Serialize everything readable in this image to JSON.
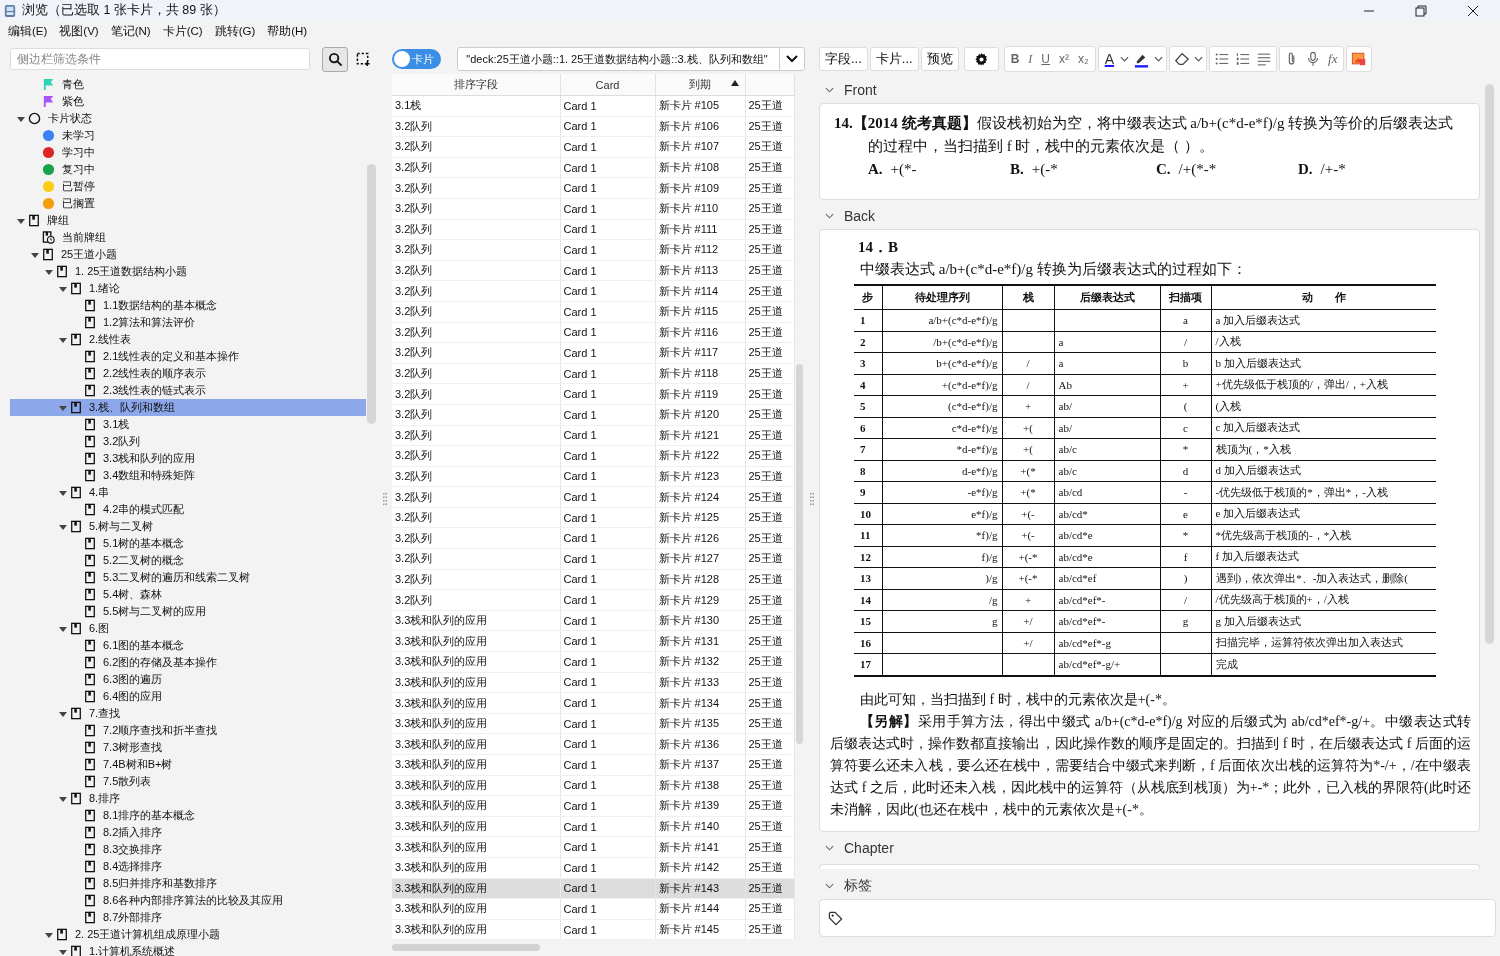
{
  "window": {
    "title": "浏览（已选取 1 张卡片，共 89 张）"
  },
  "menu": [
    "编辑(E)",
    "视图(V)",
    "笔记(N)",
    "卡片(C)",
    "跳转(G)",
    "帮助(H)"
  ],
  "sidebar": {
    "search": {
      "placeholder": "侧边栏筛选条件"
    },
    "continued_items": [
      {
        "label": "青色",
        "kind": "flag",
        "color": "#2ed3b7",
        "selected": false
      },
      {
        "label": "紫色",
        "kind": "flag",
        "color": "#a855f7",
        "selected": false
      }
    ],
    "items": [
      {
        "label": "卡片状态",
        "kind": "state",
        "expanded": true,
        "selected": false,
        "children": [
          {
            "label": "未学习",
            "kind": "dot",
            "color": "#3b82f6",
            "selected": false
          },
          {
            "label": "学习中",
            "kind": "dot",
            "color": "#dc2626",
            "selected": false
          },
          {
            "label": "复习中",
            "kind": "dot",
            "color": "#16a34a",
            "selected": false
          },
          {
            "label": "已暂停",
            "kind": "dot",
            "color": "#facc15",
            "selected": false
          },
          {
            "label": "已搁置",
            "kind": "dot",
            "color": "#f59e0b",
            "selected": false
          }
        ]
      },
      {
        "label": "牌组",
        "kind": "deck",
        "expanded": true,
        "selected": false,
        "children": [
          {
            "label": "当前牌组",
            "kind": "current",
            "selected": false
          },
          {
            "label": "25王道小题",
            "kind": "deck",
            "expanded": true,
            "selected": false,
            "children": [
              {
                "label": "1.  25王道数据结构小题",
                "kind": "deck",
                "expanded": true,
                "selected": false,
                "children": [
                  {
                    "label": "1.绪论",
                    "kind": "deck",
                    "expanded": true,
                    "selected": false,
                    "children": [
                      {
                        "label": "1.1数据结构的基本概念",
                        "kind": "deck",
                        "selected": false
                      },
                      {
                        "label": "1.2算法和算法评价",
                        "kind": "deck",
                        "selected": false
                      }
                    ]
                  },
                  {
                    "label": "2.线性表",
                    "kind": "deck",
                    "expanded": true,
                    "selected": false,
                    "children": [
                      {
                        "label": "2.1线性表的定义和基本操作",
                        "kind": "deck",
                        "selected": false
                      },
                      {
                        "label": "2.2线性表的顺序表示",
                        "kind": "deck",
                        "selected": false
                      },
                      {
                        "label": "2.3线性表的链式表示",
                        "kind": "deck",
                        "selected": false
                      }
                    ]
                  },
                  {
                    "label": "3.栈、队列和数组",
                    "kind": "deck",
                    "expanded": true,
                    "selected": true,
                    "children": [
                      {
                        "label": "3.1栈",
                        "kind": "deck",
                        "selected": false
                      },
                      {
                        "label": "3.2队列",
                        "kind": "deck",
                        "selected": false
                      },
                      {
                        "label": "3.3栈和队列的应用",
                        "kind": "deck",
                        "selected": false
                      },
                      {
                        "label": "3.4数组和特殊矩阵",
                        "kind": "deck",
                        "selected": false
                      }
                    ]
                  },
                  {
                    "label": "4.串",
                    "kind": "deck",
                    "expanded": true,
                    "selected": false,
                    "children": [
                      {
                        "label": "4.2串的模式匹配",
                        "kind": "deck",
                        "selected": false
                      }
                    ]
                  },
                  {
                    "label": "5.树与二叉树",
                    "kind": "deck",
                    "expanded": true,
                    "selected": false,
                    "children": [
                      {
                        "label": "5.1树的基本概念",
                        "kind": "deck",
                        "selected": false
                      },
                      {
                        "label": "5.2二叉树的概念",
                        "kind": "deck",
                        "selected": false
                      },
                      {
                        "label": "5.3二叉树的遍历和线索二叉树",
                        "kind": "deck",
                        "selected": false
                      },
                      {
                        "label": "5.4树、森林",
                        "kind": "deck",
                        "selected": false
                      },
                      {
                        "label": "5.5树与二叉树的应用",
                        "kind": "deck",
                        "selected": false
                      }
                    ]
                  },
                  {
                    "label": "6.图",
                    "kind": "deck",
                    "expanded": true,
                    "selected": false,
                    "children": [
                      {
                        "label": "6.1图的基本概念",
                        "kind": "deck",
                        "selected": false
                      },
                      {
                        "label": "6.2图的存储及基本操作",
                        "kind": "deck",
                        "selected": false
                      },
                      {
                        "label": "6.3图的遍历",
                        "kind": "deck",
                        "selected": false
                      },
                      {
                        "label": "6.4图的应用",
                        "kind": "deck",
                        "selected": false
                      }
                    ]
                  },
                  {
                    "label": "7.查找",
                    "kind": "deck",
                    "expanded": true,
                    "selected": false,
                    "children": [
                      {
                        "label": "7.2顺序查找和折半查找",
                        "kind": "deck",
                        "selected": false
                      },
                      {
                        "label": "7.3树形查找",
                        "kind": "deck",
                        "selected": false
                      },
                      {
                        "label": "7.4B树和B+树",
                        "kind": "deck",
                        "selected": false
                      },
                      {
                        "label": "7.5散列表",
                        "kind": "deck",
                        "selected": false
                      }
                    ]
                  },
                  {
                    "label": "8.排序",
                    "kind": "deck",
                    "expanded": true,
                    "selected": false,
                    "children": [
                      {
                        "label": "8.1排序的基本概念",
                        "kind": "deck",
                        "selected": false
                      },
                      {
                        "label": "8.2插入排序",
                        "kind": "deck",
                        "selected": false
                      },
                      {
                        "label": "8.3交换排序",
                        "kind": "deck",
                        "selected": false
                      },
                      {
                        "label": "8.4选择排序",
                        "kind": "deck",
                        "selected": false
                      },
                      {
                        "label": "8.5归并排序和基数排序",
                        "kind": "deck",
                        "selected": false
                      },
                      {
                        "label": "8.6各种内部排序算法的比较及其应用",
                        "kind": "deck",
                        "selected": false
                      },
                      {
                        "label": "8.7外部排序",
                        "kind": "deck",
                        "selected": false
                      }
                    ]
                  }
                ]
              },
              {
                "label": "2.  25王道计算机组成原理小题",
                "kind": "deck",
                "expanded": true,
                "selected": false,
                "children": [
                  {
                    "label": "1.计算机系统概述",
                    "kind": "deck",
                    "expanded": true,
                    "selected": false
                  }
                ]
              }
            ]
          }
        ]
      }
    ]
  },
  "browser": {
    "mode_toggle": {
      "label": "卡片"
    },
    "search": {
      "value": "\"deck:25王道小题::1.  25王道数据结构小题::3.栈、队列和数组\""
    },
    "table": {
      "columns": [
        {
          "label": "排序字段",
          "sorted": false
        },
        {
          "label": "Card",
          "sorted": false
        },
        {
          "label": "到期",
          "sorted": true
        },
        {
          "sorted": false
        }
      ],
      "rows": [
        {
          "sort_field": "3.1栈",
          "card": "Card 1",
          "due": "新卡片 #105",
          "column_4": "25王道",
          "selected": false
        },
        {
          "sort_field": "3.2队列",
          "card": "Card 1",
          "due": "新卡片 #106",
          "column_4": "25王道",
          "selected": false
        },
        {
          "sort_field": "3.2队列",
          "card": "Card 1",
          "due": "新卡片 #107",
          "column_4": "25王道",
          "selected": false
        },
        {
          "sort_field": "3.2队列",
          "card": "Card 1",
          "due": "新卡片 #108",
          "column_4": "25王道",
          "selected": false
        },
        {
          "sort_field": "3.2队列",
          "card": "Card 1",
          "due": "新卡片 #109",
          "column_4": "25王道",
          "selected": false
        },
        {
          "sort_field": "3.2队列",
          "card": "Card 1",
          "due": "新卡片 #110",
          "column_4": "25王道",
          "selected": false
        },
        {
          "sort_field": "3.2队列",
          "card": "Card 1",
          "due": "新卡片 #111",
          "column_4": "25王道",
          "selected": false
        },
        {
          "sort_field": "3.2队列",
          "card": "Card 1",
          "due": "新卡片 #112",
          "column_4": "25王道",
          "selected": false
        },
        {
          "sort_field": "3.2队列",
          "card": "Card 1",
          "due": "新卡片 #113",
          "column_4": "25王道",
          "selected": false
        },
        {
          "sort_field": "3.2队列",
          "card": "Card 1",
          "due": "新卡片 #114",
          "column_4": "25王道",
          "selected": false
        },
        {
          "sort_field": "3.2队列",
          "card": "Card 1",
          "due": "新卡片 #115",
          "column_4": "25王道",
          "selected": false
        },
        {
          "sort_field": "3.2队列",
          "card": "Card 1",
          "due": "新卡片 #116",
          "column_4": "25王道",
          "selected": false
        },
        {
          "sort_field": "3.2队列",
          "card": "Card 1",
          "due": "新卡片 #117",
          "column_4": "25王道",
          "selected": false
        },
        {
          "sort_field": "3.2队列",
          "card": "Card 1",
          "due": "新卡片 #118",
          "column_4": "25王道",
          "selected": false
        },
        {
          "sort_field": "3.2队列",
          "card": "Card 1",
          "due": "新卡片 #119",
          "column_4": "25王道",
          "selected": false
        },
        {
          "sort_field": "3.2队列",
          "card": "Card 1",
          "due": "新卡片 #120",
          "column_4": "25王道",
          "selected": false
        },
        {
          "sort_field": "3.2队列",
          "card": "Card 1",
          "due": "新卡片 #121",
          "column_4": "25王道",
          "selected": false
        },
        {
          "sort_field": "3.2队列",
          "card": "Card 1",
          "due": "新卡片 #122",
          "column_4": "25王道",
          "selected": false
        },
        {
          "sort_field": "3.2队列",
          "card": "Card 1",
          "due": "新卡片 #123",
          "column_4": "25王道",
          "selected": false
        },
        {
          "sort_field": "3.2队列",
          "card": "Card 1",
          "due": "新卡片 #124",
          "column_4": "25王道",
          "selected": false
        },
        {
          "sort_field": "3.2队列",
          "card": "Card 1",
          "due": "新卡片 #125",
          "column_4": "25王道",
          "selected": false
        },
        {
          "sort_field": "3.2队列",
          "card": "Card 1",
          "due": "新卡片 #126",
          "column_4": "25王道",
          "selected": false
        },
        {
          "sort_field": "3.2队列",
          "card": "Card 1",
          "due": "新卡片 #127",
          "column_4": "25王道",
          "selected": false
        },
        {
          "sort_field": "3.2队列",
          "card": "Card 1",
          "due": "新卡片 #128",
          "column_4": "25王道",
          "selected": false
        },
        {
          "sort_field": "3.2队列",
          "card": "Card 1",
          "due": "新卡片 #129",
          "column_4": "25王道",
          "selected": false
        },
        {
          "sort_field": "3.3栈和队列的应用",
          "card": "Card 1",
          "due": "新卡片 #130",
          "column_4": "25王道",
          "selected": false
        },
        {
          "sort_field": "3.3栈和队列的应用",
          "card": "Card 1",
          "due": "新卡片 #131",
          "column_4": "25王道",
          "selected": false
        },
        {
          "sort_field": "3.3栈和队列的应用",
          "card": "Card 1",
          "due": "新卡片 #132",
          "column_4": "25王道",
          "selected": false
        },
        {
          "sort_field": "3.3栈和队列的应用",
          "card": "Card 1",
          "due": "新卡片 #133",
          "column_4": "25王道",
          "selected": false
        },
        {
          "sort_field": "3.3栈和队列的应用",
          "card": "Card 1",
          "due": "新卡片 #134",
          "column_4": "25王道",
          "selected": false
        },
        {
          "sort_field": "3.3栈和队列的应用",
          "card": "Card 1",
          "due": "新卡片 #135",
          "column_4": "25王道",
          "selected": false
        },
        {
          "sort_field": "3.3栈和队列的应用",
          "card": "Card 1",
          "due": "新卡片 #136",
          "column_4": "25王道",
          "selected": false
        },
        {
          "sort_field": "3.3栈和队列的应用",
          "card": "Card 1",
          "due": "新卡片 #137",
          "column_4": "25王道",
          "selected": false
        },
        {
          "sort_field": "3.3栈和队列的应用",
          "card": "Card 1",
          "due": "新卡片 #138",
          "column_4": "25王道",
          "selected": false
        },
        {
          "sort_field": "3.3栈和队列的应用",
          "card": "Card 1",
          "due": "新卡片 #139",
          "column_4": "25王道",
          "selected": false
        },
        {
          "sort_field": "3.3栈和队列的应用",
          "card": "Card 1",
          "due": "新卡片 #140",
          "column_4": "25王道",
          "selected": false
        },
        {
          "sort_field": "3.3栈和队列的应用",
          "card": "Card 1",
          "due": "新卡片 #141",
          "column_4": "25王道",
          "selected": false
        },
        {
          "sort_field": "3.3栈和队列的应用",
          "card": "Card 1",
          "due": "新卡片 #142",
          "column_4": "25王道",
          "selected": false
        },
        {
          "sort_field": "3.3栈和队列的应用",
          "card": "Card 1",
          "due": "新卡片 #143",
          "column_4": "25王道",
          "selected": true
        },
        {
          "sort_field": "3.3栈和队列的应用",
          "card": "Card 1",
          "due": "新卡片 #144",
          "column_4": "25王道",
          "selected": false
        },
        {
          "sort_field": "3.3栈和队列的应用",
          "card": "Card 1",
          "due": "新卡片 #145",
          "column_4": "25王道",
          "selected": false
        }
      ]
    }
  },
  "editor": {
    "toolbar": {
      "buttons": [
        "字段...",
        "卡片...",
        "预览"
      ],
      "format_buttons": [
        "B",
        "I",
        "U",
        "x²",
        "x₂"
      ],
      "font_color_label": "A",
      "formula_label": "fx"
    },
    "fields": [
      {
        "name": "Front",
        "kind": "front",
        "question": {
          "lead": "14.【2014 统考真题】",
          "text": "假设栈初始为空，将中缀表达式 a/b+(c*d-e*f)/g 转换为等价的后缀表达式的过程中，当扫描到 f 时，栈中的元素依次是（    ）。",
          "options": [
            {
              "letter": "A.",
              "text": "+(*-"
            },
            {
              "letter": "B.",
              "text": "+(-*"
            },
            {
              "letter": "C.",
              "text": "/+(*-*"
            },
            {
              "letter": "D.",
              "text": "/+-*"
            }
          ]
        }
      },
      {
        "name": "Back",
        "kind": "back",
        "answer": "14．B",
        "intro": "中缀表达式 a/b+(c*d-e*f)/g 转换为后缀表达式的过程如下：",
        "table": {
          "columns": [
            "步",
            "待处理序列",
            "栈",
            "后缀表达式",
            "扫描项",
            "动　　作"
          ],
          "rows": [
            {
              "step": "1",
              "remaining": "a/b+(c*d-e*f)/g",
              "scanned": "a",
              "action": "a 加入后缀表达式"
            },
            {
              "step": "2",
              "remaining": "/b+(c*d-e*f)/g",
              "postfix": "a",
              "scanned": "/",
              "action": "/入栈"
            },
            {
              "step": "3",
              "remaining": "b+(c*d-e*f)/g",
              "stack": "/",
              "postfix": "a",
              "scanned": "b",
              "action": "b 加入后缀表达式"
            },
            {
              "step": "4",
              "remaining": "+(c*d-e*f)/g",
              "stack": "/",
              "postfix": "Ab",
              "scanned": "+",
              "action": "+优先级低于栈顶的/，弹出/，+入栈"
            },
            {
              "step": "5",
              "remaining": "(c*d-e*f)/g",
              "stack": "+",
              "postfix": "ab/",
              "scanned": "(",
              "action": "(入栈"
            },
            {
              "step": "6",
              "remaining": "c*d-e*f)/g",
              "stack": "+(",
              "postfix": "ab/",
              "scanned": "c",
              "action": "c 加入后缀表达式"
            },
            {
              "step": "7",
              "remaining": "*d-e*f)/g",
              "stack": "+(",
              "postfix": "ab/c",
              "scanned": "*",
              "action": "栈顶为(，*入栈"
            },
            {
              "step": "8",
              "remaining": "d-e*f)/g",
              "stack": "+(*",
              "postfix": "ab/c",
              "scanned": "d",
              "action": "d 加入后缀表达式"
            },
            {
              "step": "9",
              "remaining": "-e*f)/g",
              "stack": "+(*",
              "postfix": "ab/cd",
              "scanned": "-",
              "action": "-优先级低于栈顶的*，弹出*，-入栈"
            },
            {
              "step": "10",
              "remaining": "e*f)/g",
              "stack": "+(-",
              "postfix": "ab/cd*",
              "scanned": "e",
              "action": "e 加入后缀表达式"
            },
            {
              "step": "11",
              "remaining": "*f)/g",
              "stack": "+(-",
              "postfix": "ab/cd*e",
              "scanned": "*",
              "action": "*优先级高于栈顶的-，*入栈"
            },
            {
              "step": "12",
              "remaining": "f)/g",
              "stack": "+(-*",
              "postfix": "ab/cd*e",
              "scanned": "f",
              "action": "f 加入后缀表达式"
            },
            {
              "step": "13",
              "remaining": ")/g",
              "stack": "+(-*",
              "postfix": "ab/cd*ef",
              "scanned": ")",
              "action": "遇到)，依次弹出*、-加入表达式，删除("
            },
            {
              "step": "14",
              "remaining": "/g",
              "stack": "+",
              "postfix": "ab/cd*ef*-",
              "scanned": "/",
              "action": "/优先级高于栈顶的+，/入栈"
            },
            {
              "step": "15",
              "remaining": "g",
              "stack": "+/",
              "postfix": "ab/cd*ef*-",
              "scanned": "g",
              "action": "g 加入后缀表达式"
            },
            {
              "step": "16",
              "stack": "+/",
              "postfix": "ab/cd*ef*-g",
              "action": "扫描完毕，运算符依次弹出加入表达式"
            },
            {
              "step": "17",
              "postfix": "ab/cd*ef*-g/+",
              "action": "完成"
            }
          ]
        },
        "paragraphs": [
          {
            "text": "由此可知，当扫描到 f 时，栈中的元素依次是+(-*。"
          },
          {
            "lead": "【另解】",
            "text": "采用手算方法，得出中缀式 a/b+(c*d-e*f)/g 对应的后缀式为 ab/cd*ef*-g/+。中缀表达式转后缀表达式时，操作数都直接输出，因此操作数的顺序是固定的。扫描到 f 时，在后缀表达式 f 后面的运算符要么还未入栈，要么还在栈中，需要结合中缀式来判断，f 后面依次出栈的运算符为*-/+，/在中缀表达式 f 之后，此时还未入栈，因此栈中的运算符（从栈底到栈顶）为+-*；此外，已入栈的界限符(此时还未消解，因此(也还在栈中，栈中的元素依次是+(-*。"
          }
        ]
      },
      {
        "name": "Chapter",
        "kind": "chapter"
      }
    ],
    "tags": {
      "label": "标签"
    }
  }
}
